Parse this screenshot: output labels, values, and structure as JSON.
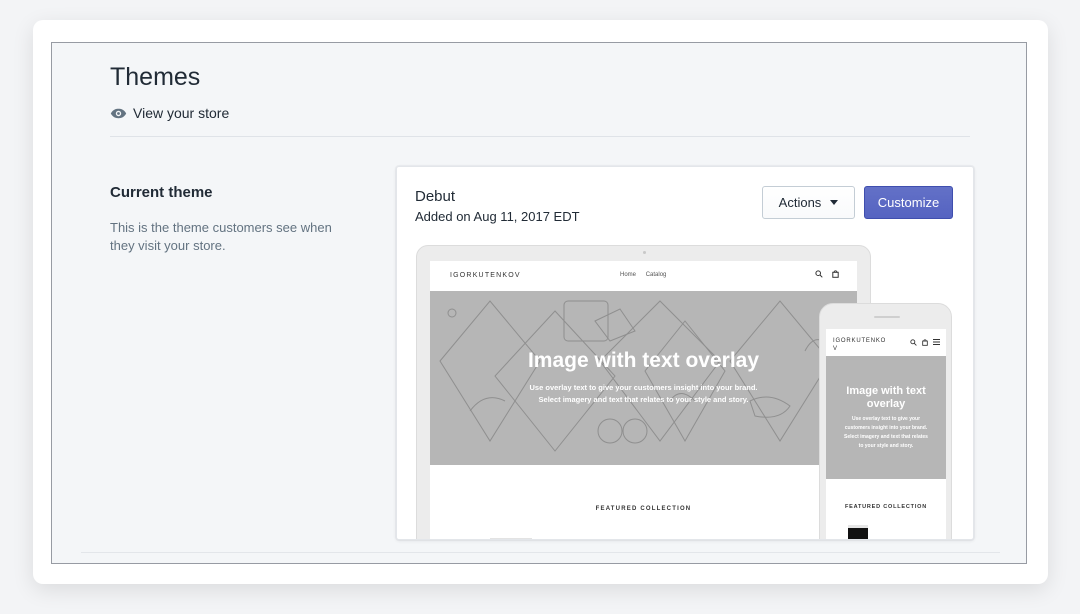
{
  "header": {
    "title": "Themes",
    "view_store_label": "View your store"
  },
  "current_theme_section": {
    "title": "Current theme",
    "description": "This is the theme customers see when they visit your store."
  },
  "theme_card": {
    "name": "Debut",
    "added": "Added on Aug 11, 2017 EDT",
    "actions_label": "Actions",
    "customize_label": "Customize"
  },
  "preview": {
    "desktop": {
      "brand": "IGORKUTENKOV",
      "nav_items": [
        "Home",
        "Catalog"
      ],
      "hero_title": "Image with text overlay",
      "hero_subtitle_lines": [
        "Use overlay text to give your customers insight into your brand.",
        "Select imagery and text that relates to your style and story."
      ],
      "featured_label": "FEATURED COLLECTION"
    },
    "mobile": {
      "brand_lines": [
        "IGORKUTENKO",
        "V"
      ],
      "hero_title": "Image with text overlay",
      "hero_subtitle_lines": [
        "Use overlay text to give your",
        "customers insight into your brand.",
        "Select imagery and text that relates",
        "to your style and story."
      ],
      "featured_label": "FEATURED COLLECTION"
    }
  },
  "colors": {
    "primary_button": "#5c6ac4",
    "page_background": "#f4f6f8",
    "hero_gray": "#b6b6b6"
  },
  "icons": {
    "view_store": "eye-icon",
    "search": "search-icon",
    "cart": "bag-icon",
    "menu": "hamburger-menu-icon",
    "dropdown": "caret-down-icon"
  }
}
